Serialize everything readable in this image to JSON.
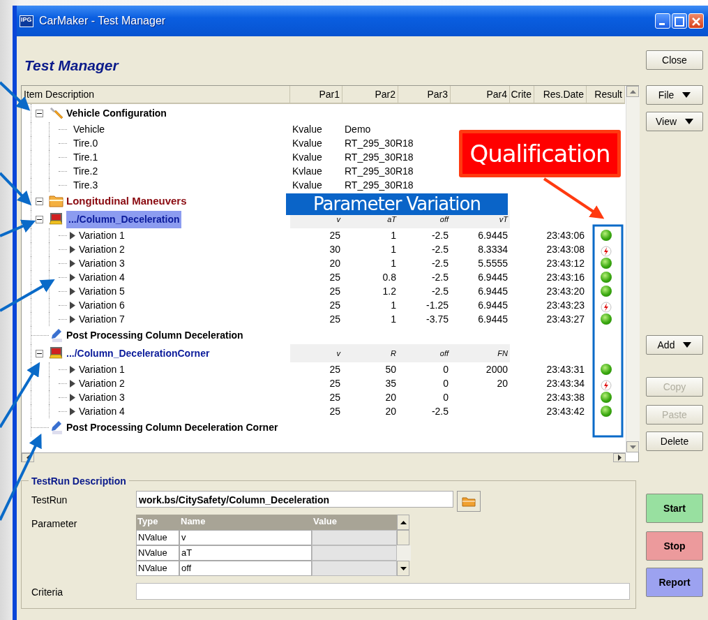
{
  "window": {
    "title": "CarMaker - Test Manager",
    "app_icon_text": "IPG"
  },
  "heading": "Test Manager",
  "columns": [
    "Item Description",
    "Par1",
    "Par2",
    "Par3",
    "Par4",
    "Crite",
    "Res.Date",
    "Result"
  ],
  "tree": [
    {
      "kind": "config",
      "label": "Vehicle Configuration",
      "expanded": true,
      "children": [
        {
          "kind": "param",
          "label": "Vehicle",
          "par1": "Kvalue",
          "par2": "Demo"
        },
        {
          "kind": "param",
          "label": "Tire.0",
          "par1": "Kvalue",
          "par2": "RT_295_30R18"
        },
        {
          "kind": "param",
          "label": "Tire.1",
          "par1": "Kvalue",
          "par2": "RT_295_30R18"
        },
        {
          "kind": "param",
          "label": "Tire.2",
          "par1": "Kvlaue",
          "par2": "RT_295_30R18"
        },
        {
          "kind": "param",
          "label": "Tire.3",
          "par1": "Kvalue",
          "par2": "RT_295_30R18"
        }
      ]
    },
    {
      "kind": "folder",
      "label": "Longitudinal Maneuvers",
      "expanded": true
    },
    {
      "kind": "testrun",
      "label": ".../Column_Deceleration",
      "expanded": true,
      "selected": true,
      "params": [
        "v",
        "aT",
        "off",
        "vT"
      ],
      "children": [
        {
          "kind": "variation",
          "label": "Variation 1",
          "values": [
            "25",
            "1",
            "-2.5",
            "6.9445"
          ],
          "date": "23:43:06",
          "passed": true
        },
        {
          "kind": "variation",
          "label": "Variation 2",
          "values": [
            "30",
            "1",
            "-2.5",
            "8.3334"
          ],
          "date": "23:43:08",
          "passed": false
        },
        {
          "kind": "variation",
          "label": "Variation 3",
          "values": [
            "20",
            "1",
            "-2.5",
            "5.5555"
          ],
          "date": "23:43:12",
          "passed": true
        },
        {
          "kind": "variation",
          "label": "Variation 4",
          "values": [
            "25",
            "0.8",
            "-2.5",
            "6.9445"
          ],
          "date": "23:43:16",
          "passed": true
        },
        {
          "kind": "variation",
          "label": "Variation 5",
          "values": [
            "25",
            "1.2",
            "-2.5",
            "6.9445"
          ],
          "date": "23:43:20",
          "passed": true
        },
        {
          "kind": "variation",
          "label": "Variation 6",
          "values": [
            "25",
            "1",
            "-1.25",
            "6.9445"
          ],
          "date": "23:43:23",
          "passed": false
        },
        {
          "kind": "variation",
          "label": "Variation 7",
          "values": [
            "25",
            "1",
            "-3.75",
            "6.9445"
          ],
          "date": "23:43:27",
          "passed": true
        }
      ]
    },
    {
      "kind": "command",
      "label": "Post Processing Column Deceleration"
    },
    {
      "kind": "testrun",
      "label": ".../Column_DecelerationCorner",
      "expanded": true,
      "selected": false,
      "params": [
        "v",
        "R",
        "off",
        "FN"
      ],
      "children": [
        {
          "kind": "variation",
          "label": "Variation 1",
          "values": [
            "25",
            "50",
            "0",
            "2000"
          ],
          "date": "23:43:31",
          "passed": true
        },
        {
          "kind": "variation",
          "label": "Variation 2",
          "values": [
            "25",
            "35",
            "0",
            "20"
          ],
          "date": "23:43:34",
          "passed": false
        },
        {
          "kind": "variation",
          "label": "Variation 3",
          "values": [
            "25",
            "20",
            "0"
          ],
          "date": "23:43:38",
          "passed": true
        },
        {
          "kind": "variation",
          "label": "Variation 4",
          "values": [
            "25",
            "20",
            "-2.5"
          ],
          "date": "23:43:42",
          "passed": true
        }
      ]
    },
    {
      "kind": "command",
      "label": "Post Processing Column Deceleration Corner"
    }
  ],
  "side_buttons": [
    {
      "label": "Close",
      "kind": "plain",
      "disabled": false
    },
    {
      "label": "File",
      "kind": "menu",
      "disabled": false
    },
    {
      "label": "View",
      "kind": "menu",
      "disabled": false
    },
    {
      "label": "Add",
      "kind": "menu",
      "disabled": false
    },
    {
      "label": "Copy",
      "kind": "plain",
      "disabled": true
    },
    {
      "label": "Paste",
      "kind": "plain",
      "disabled": true
    },
    {
      "label": "Delete",
      "kind": "plain",
      "disabled": false
    },
    {
      "label": "Start",
      "kind": "start",
      "disabled": false
    },
    {
      "label": "Stop",
      "kind": "stop",
      "disabled": false
    },
    {
      "label": "Report",
      "kind": "report",
      "disabled": false
    }
  ],
  "testrun_description": {
    "title": "TestRun Description",
    "testrun_label": "TestRun",
    "testrun_value": "work.bs/CitySafety/Column_Deceleration",
    "parameter_label": "Parameter",
    "parameter_columns": [
      "Type",
      "Name",
      "Value"
    ],
    "parameter_rows": [
      {
        "type": "NValue",
        "name": "v"
      },
      {
        "type": "NValue",
        "name": "aT"
      },
      {
        "type": "NValue",
        "name": "off"
      }
    ],
    "criteria_label": "Criteria"
  },
  "annotations": [
    {
      "kind": "callout",
      "text": "Qualification"
    },
    {
      "kind": "banner",
      "text": "Parameter Variation"
    }
  ]
}
